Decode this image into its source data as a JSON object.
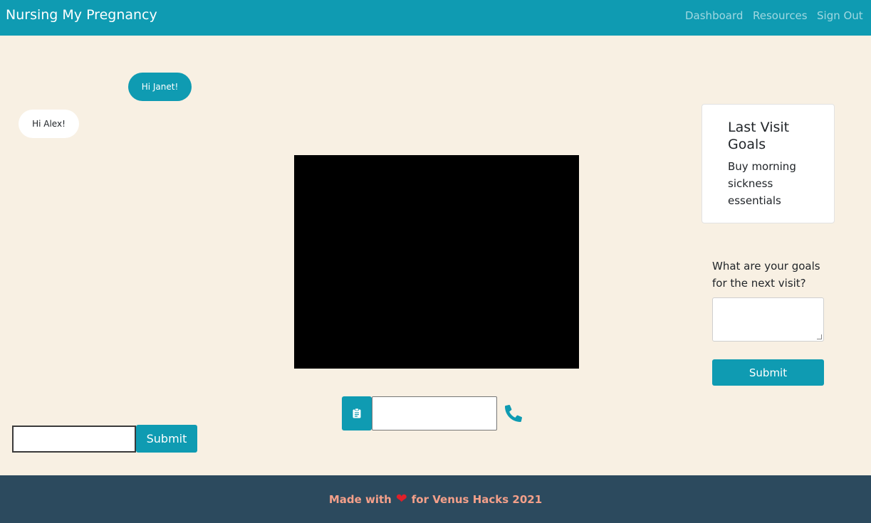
{
  "navbar": {
    "brand": "Nursing My Pregnancy",
    "links": [
      {
        "label": "Dashboard"
      },
      {
        "label": "Resources"
      },
      {
        "label": "Sign Out"
      }
    ]
  },
  "chat": {
    "messages": [
      {
        "text": "Hi Janet!",
        "side": "sent"
      },
      {
        "text": "Hi Alex!",
        "side": "received"
      }
    ],
    "input_value": "",
    "submit_label": "Submit"
  },
  "call": {
    "copy_icon": "clipboard-icon",
    "peer_id_value": "",
    "call_icon": "phone-icon"
  },
  "goals": {
    "last_title": "Last Visit Goals",
    "last_text": "Buy morning sickness essentials",
    "next_question": "What are your goals for the next visit?",
    "next_value": "",
    "submit_label": "Submit"
  },
  "footer": {
    "prefix": "Made with",
    "icon": "heart-icon",
    "suffix": "for Venus Hacks 2021"
  },
  "colors": {
    "primary": "#0f9bb2",
    "background": "#f8f0e3",
    "footer_bg": "#2c4a5e",
    "footer_text": "#f4a08a",
    "heart": "#e0202a"
  }
}
